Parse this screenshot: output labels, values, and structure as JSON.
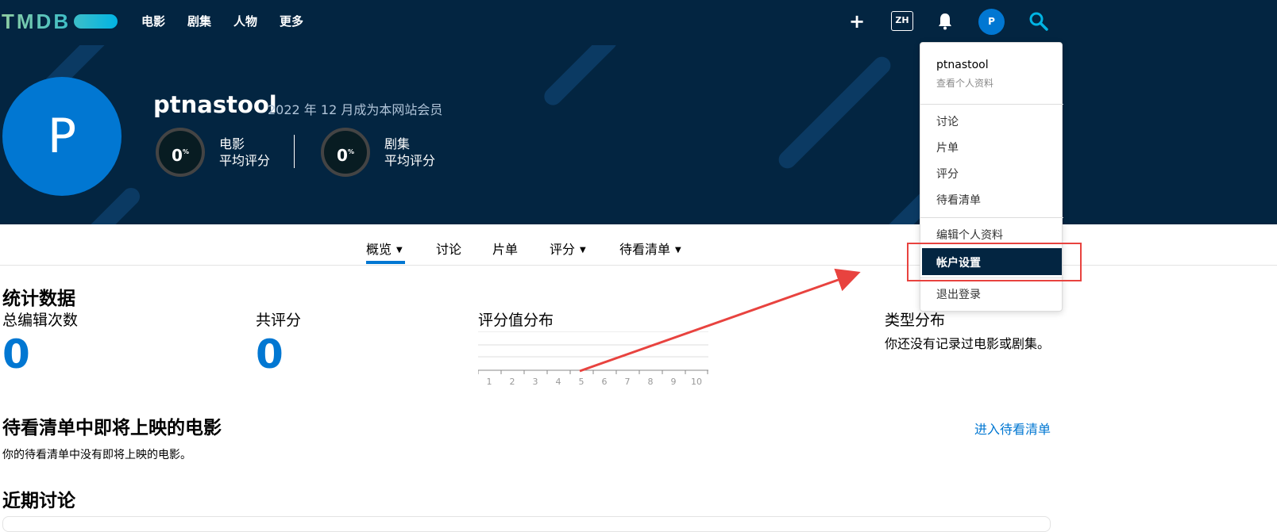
{
  "topnav": {
    "logo": "TMDB",
    "links": [
      "电影",
      "剧集",
      "人物",
      "更多"
    ],
    "lang": "ZH",
    "avatar_initial": "P",
    "icons": [
      "plus-icon",
      "bell-icon",
      "search-icon"
    ]
  },
  "profile": {
    "initial": "P",
    "username": "ptnastool",
    "member_since": "2022 年 12 月成为本网站会员",
    "scores": [
      {
        "value": "0",
        "unit": "%",
        "label1": "电影",
        "label2": "平均评分"
      },
      {
        "value": "0",
        "unit": "%",
        "label1": "剧集",
        "label2": "平均评分"
      }
    ]
  },
  "tabs": [
    {
      "label": "概览",
      "caret": "▼"
    },
    {
      "label": "讨论",
      "caret": ""
    },
    {
      "label": "片单",
      "caret": ""
    },
    {
      "label": "评分",
      "caret": "▼"
    },
    {
      "label": "待看清单",
      "caret": "▼"
    }
  ],
  "stats": {
    "title": "统计数据",
    "total_edits_label": "总编辑次数",
    "total_edits_value": "0",
    "total_ratings_label": "共评分",
    "total_ratings_value": "0",
    "rating_dist_label": "评分值分布",
    "rating_axis": [
      "1",
      "2",
      "3",
      "4",
      "5",
      "6",
      "7",
      "8",
      "9",
      "10"
    ],
    "genre_label": "类型分布",
    "genre_empty": "你还没有记录过电影或剧集。"
  },
  "watchlist": {
    "title": "待看清单中即将上映的电影",
    "empty": "你的待看清单中没有即将上映的电影。",
    "link": "进入待看清单"
  },
  "discussions": {
    "title": "近期讨论"
  },
  "dropdown": {
    "username": "ptnastool",
    "view_profile": "查看个人资料",
    "items": [
      "讨论",
      "片单",
      "评分",
      "待看清单"
    ],
    "edit_profile": "编辑个人资料",
    "account_settings": "帐户设置",
    "logout": "退出登录"
  },
  "colors": {
    "nav_bg": "#032541",
    "accent": "#0177d2",
    "annotation": "#e8433f"
  }
}
